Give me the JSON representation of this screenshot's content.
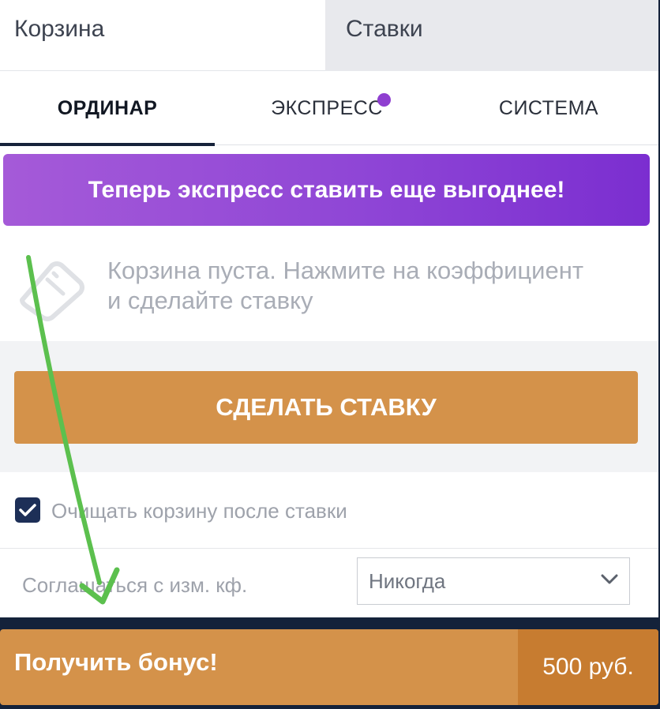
{
  "top_tabs": {
    "basket": "Корзина",
    "bets": "Ставки"
  },
  "bet_types": {
    "single": "ОРДИНАР",
    "express": "ЭКСПРЕСС",
    "system": "СИСТЕМА"
  },
  "promo": {
    "text": "Теперь экспресс ставить еще выгоднее!"
  },
  "empty_state": {
    "line1": "Корзина пуста. Нажмите на коэффициент",
    "line2": "и сделайте ставку"
  },
  "bet_button": {
    "label": "СДЕЛАТЬ СТАВКУ"
  },
  "clear_basket": {
    "label": "Очищать корзину после ставки",
    "checked": true
  },
  "odds_change": {
    "label": "Соглашаться с изм. кф.",
    "selected": "Никогда"
  },
  "bonus": {
    "label": "Получить бонус!",
    "amount": "500 руб."
  },
  "colors": {
    "accent_orange": "#d4924a",
    "accent_orange_dark": "#c77c30",
    "promo_purple": "#8f46d6",
    "navy": "#16223a",
    "arrow_green": "#5cc04e"
  }
}
